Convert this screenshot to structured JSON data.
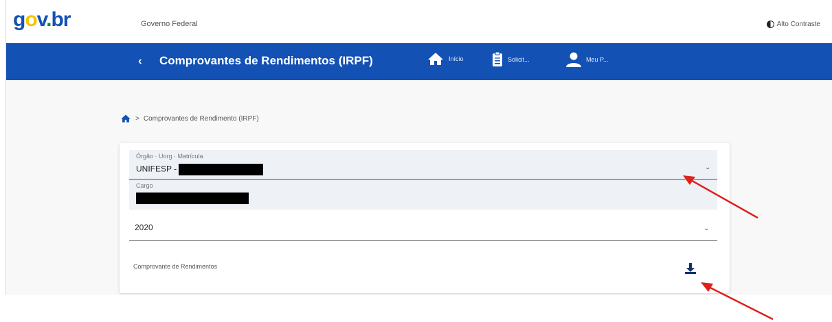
{
  "header": {
    "logo": {
      "g": "g",
      "o": "o",
      "v": "v",
      "dot": ".",
      "b": "b",
      "r": "r"
    },
    "gov_federal": "Governo Federal",
    "contrast_label": "Alto Contraste"
  },
  "navbar": {
    "title": "Comprovantes de Rendimentos (IRPF)",
    "items": [
      {
        "label": "Início",
        "icon": "home-icon"
      },
      {
        "label": "Solicit...",
        "icon": "clipboard-icon"
      },
      {
        "label": "Meu P...",
        "icon": "user-icon"
      }
    ]
  },
  "breadcrumb": {
    "separator": ">",
    "current": "Comprovantes de Rendimento (IRPF)"
  },
  "form": {
    "orgao_label": "Órgão · Uorg · Matrícula",
    "orgao_value": "UNIFESP -",
    "cargo_label": "Cargo",
    "year_value": "2020",
    "document_label": "Comprovante de Rendimentos"
  },
  "colors": {
    "brand_blue": "#1351b4",
    "annotation_red": "#e0201c"
  }
}
